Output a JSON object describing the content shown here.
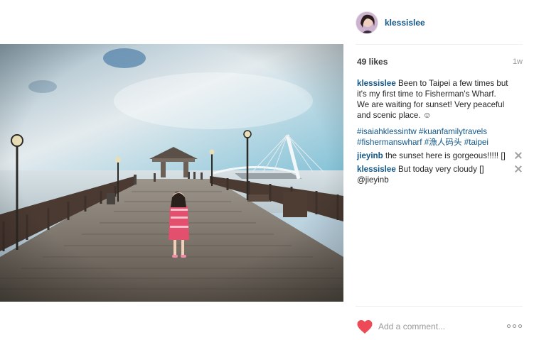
{
  "post": {
    "username": "klessislee",
    "likes": "49 likes",
    "age": "1w",
    "caption": {
      "user": "klessislee",
      "text": "Been to Taipei a few times but it's my first time to Fisherman's Wharf. We are waiting for sunset! Very peaceful and scenic place. ☺"
    },
    "hashtags": [
      "#isaiahklessintw",
      "#kuanfamilytravels",
      "#fishermanswharf",
      "#漁人码头",
      "#taipei"
    ],
    "comments": [
      {
        "user": "jieyinb",
        "text": "the sunset here is gorgeous!!!!! []"
      },
      {
        "user": "klessislee",
        "text": "But today very cloudy [] @jieyinb"
      }
    ]
  },
  "footer": {
    "add_comment_placeholder": "Add a comment...",
    "like_color": "#ed4956"
  },
  "icons": [
    "heart-icon",
    "close-icon",
    "more-options-icon"
  ]
}
